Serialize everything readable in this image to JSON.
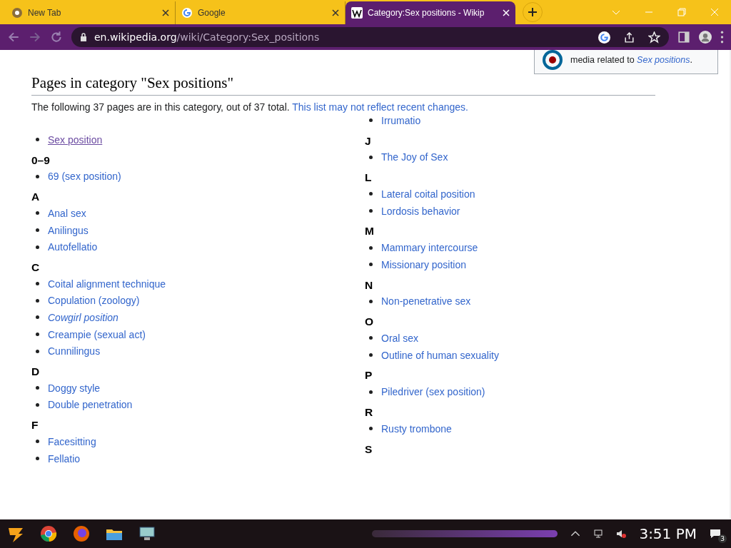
{
  "tabs": [
    {
      "title": "New Tab",
      "selected": false
    },
    {
      "title": "Google",
      "selected": false
    },
    {
      "title": "Category:Sex positions - Wikip",
      "selected": true
    }
  ],
  "address": {
    "domain": "en.wikipedia.org",
    "path": "/wiki/Category:Sex_positions"
  },
  "commons_box": {
    "text": "media related to ",
    "link": "Sex positions",
    "tail": "."
  },
  "heading": "Pages in category \"Sex positions\"",
  "intro": {
    "text": "The following 37 pages are in this category, out of 37 total. ",
    "link": "This list may not reflect recent changes."
  },
  "columns": [
    {
      "groups": [
        {
          "items": [
            {
              "text": "Sex position",
              "kind": "visited"
            }
          ]
        },
        {
          "heading": "0–9",
          "items": [
            {
              "text": "69 (sex position)",
              "kind": "link"
            }
          ]
        },
        {
          "heading": "A",
          "items": [
            {
              "text": "Anal sex",
              "kind": "link"
            },
            {
              "text": "Anilingus",
              "kind": "link"
            },
            {
              "text": "Autofellatio",
              "kind": "link"
            }
          ]
        },
        {
          "heading": "C",
          "items": [
            {
              "text": "Coital alignment technique",
              "kind": "link"
            },
            {
              "text": "Copulation (zoology)",
              "kind": "link"
            },
            {
              "text": "Cowgirl position",
              "kind": "italic"
            },
            {
              "text": "Creampie (sexual act)",
              "kind": "link"
            },
            {
              "text": "Cunnilingus",
              "kind": "link"
            }
          ]
        },
        {
          "heading": "D",
          "items": [
            {
              "text": "Doggy style",
              "kind": "link"
            },
            {
              "text": "Double penetration",
              "kind": "link"
            }
          ]
        },
        {
          "heading": "F",
          "items": [
            {
              "text": "Facesitting",
              "kind": "link"
            },
            {
              "text": "Fellatio",
              "kind": "link"
            }
          ]
        }
      ]
    },
    {
      "groups": [
        {
          "items": [
            {
              "text": "Irrumatio",
              "kind": "link"
            }
          ]
        },
        {
          "heading": "J",
          "items": [
            {
              "text": "The Joy of Sex",
              "kind": "link"
            }
          ]
        },
        {
          "heading": "L",
          "items": [
            {
              "text": "Lateral coital position",
              "kind": "link"
            },
            {
              "text": "Lordosis behavior",
              "kind": "link"
            }
          ]
        },
        {
          "heading": "M",
          "items": [
            {
              "text": "Mammary intercourse",
              "kind": "link"
            },
            {
              "text": "Missionary position",
              "kind": "link"
            }
          ]
        },
        {
          "heading": "N",
          "items": [
            {
              "text": "Non-penetrative sex",
              "kind": "link"
            }
          ]
        },
        {
          "heading": "O",
          "items": [
            {
              "text": "Oral sex",
              "kind": "link"
            },
            {
              "text": "Outline of human sexuality",
              "kind": "link"
            }
          ]
        },
        {
          "heading": "P",
          "items": [
            {
              "text": "Piledriver (sex position)",
              "kind": "link"
            }
          ]
        },
        {
          "heading": "R",
          "items": [
            {
              "text": "Rusty trombone",
              "kind": "link"
            }
          ]
        },
        {
          "heading": "S"
        }
      ]
    }
  ],
  "taskbar": {
    "clock": "3:51 PM",
    "notifications": "3"
  }
}
